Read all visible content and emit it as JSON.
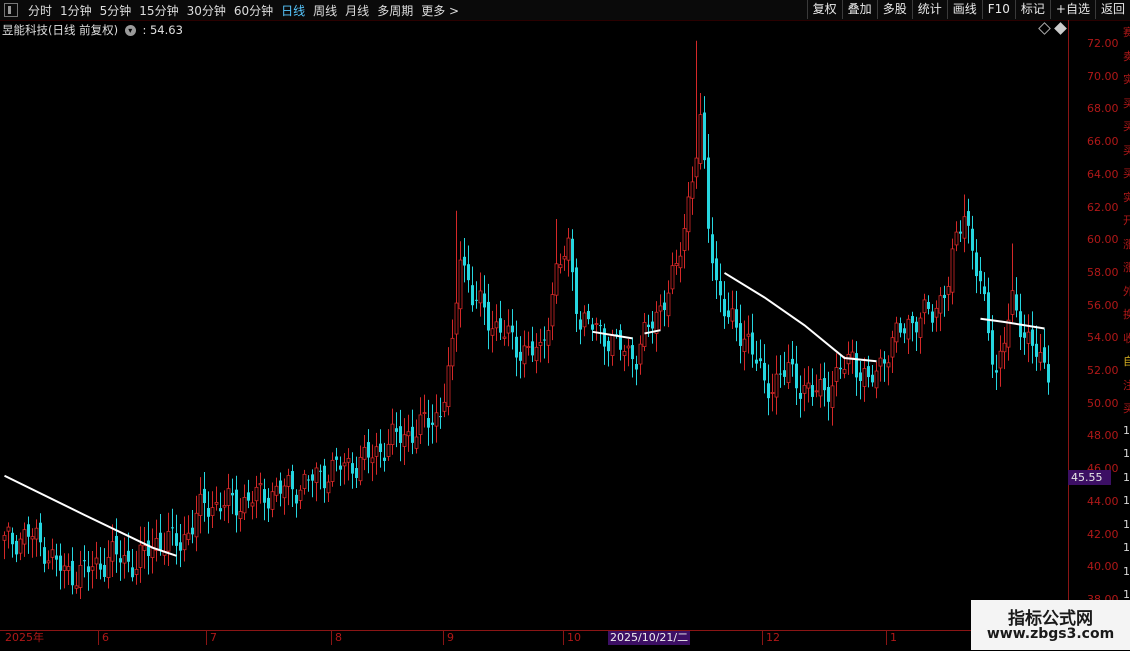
{
  "toolbar": {
    "periods": [
      "分时",
      "1分钟",
      "5分钟",
      "15分钟",
      "30分钟",
      "60分钟",
      "日线",
      "周线",
      "月线",
      "多周期",
      "更多 >"
    ],
    "active_period": "日线",
    "tools": [
      "复权",
      "叠加",
      "多股",
      "统计",
      "画线",
      "F10",
      "标记",
      "+自选",
      "返回"
    ]
  },
  "stock": {
    "name": "昱能科技(日线 前复权)",
    "indicator_text": ": 54.63"
  },
  "price_tag": "45.55",
  "side_labels": [
    {
      "text": "赛",
      "color": "#b01818"
    },
    {
      "text": "卖",
      "color": "#b01818"
    },
    {
      "text": "实",
      "color": "#b01818"
    },
    {
      "text": "买",
      "color": "#b01818"
    },
    {
      "text": "买",
      "color": "#b01818"
    },
    {
      "text": "买",
      "color": "#b01818"
    },
    {
      "text": "买",
      "color": "#b01818"
    },
    {
      "text": "实",
      "color": "#b01818"
    },
    {
      "text": "开",
      "color": "#b01818"
    },
    {
      "text": "涨",
      "color": "#b01818"
    },
    {
      "text": "涨",
      "color": "#b01818"
    },
    {
      "text": "外",
      "color": "#b01818"
    },
    {
      "text": "换",
      "color": "#b01818"
    },
    {
      "text": "收",
      "color": "#b01818"
    },
    {
      "text": "自",
      "color": "#d8b020"
    },
    {
      "text": "注",
      "color": "#b01818"
    },
    {
      "text": "买",
      "color": "#b01818"
    },
    {
      "text": "1",
      "color": "#d8d8d8"
    },
    {
      "text": "1",
      "color": "#d8d8d8"
    },
    {
      "text": "1",
      "color": "#d8d8d8"
    },
    {
      "text": "1",
      "color": "#d8d8d8"
    },
    {
      "text": "1",
      "color": "#d8d8d8"
    },
    {
      "text": "1",
      "color": "#d8d8d8"
    },
    {
      "text": "1",
      "color": "#d8d8d8"
    },
    {
      "text": "1",
      "color": "#d8d8d8"
    },
    {
      "text": "1",
      "color": "#d8d8d8"
    }
  ],
  "x_axis": {
    "labels": [
      "2025年",
      "6",
      "7",
      "8",
      "9",
      "10",
      "12",
      "1"
    ],
    "selected_date": "2025/10/21/二"
  },
  "watermark": {
    "title": "指标公式网",
    "url": "www.zbgs3.com"
  },
  "chart_data": {
    "type": "candlestick",
    "ylim": [
      36.8,
      73.2
    ],
    "y_ticks": [
      "72.00",
      "70.00",
      "68.00",
      "66.00",
      "64.00",
      "62.00",
      "60.00",
      "58.00",
      "56.00",
      "54.00",
      "52.00",
      "50.00",
      "48.00",
      "46.00",
      "44.00",
      "42.00",
      "40.00",
      "38.00"
    ],
    "colors": {
      "up": "#d42828",
      "down": "#26d6e0",
      "line": "#ffffff"
    },
    "waypoints": [
      {
        "bar": 0,
        "close": 41.5
      },
      {
        "bar": 6,
        "close": 42.0
      },
      {
        "bar": 10,
        "close": 41.2
      },
      {
        "bar": 15,
        "close": 39.6
      },
      {
        "bar": 21,
        "close": 39.8
      },
      {
        "bar": 27,
        "close": 40.7
      },
      {
        "bar": 33,
        "close": 40.2
      },
      {
        "bar": 38,
        "close": 41.6
      },
      {
        "bar": 44,
        "close": 41.5
      },
      {
        "bar": 50,
        "close": 43.8
      },
      {
        "bar": 58,
        "close": 43.9
      },
      {
        "bar": 66,
        "close": 44.5
      },
      {
        "bar": 74,
        "close": 45.0
      },
      {
        "bar": 82,
        "close": 46.0
      },
      {
        "bar": 90,
        "close": 46.5
      },
      {
        "bar": 97,
        "close": 47.8
      },
      {
        "bar": 104,
        "close": 48.5
      },
      {
        "bar": 109,
        "close": 49.5
      },
      {
        "bar": 112,
        "close": 53.0
      },
      {
        "bar": 114,
        "close": 59.5
      },
      {
        "bar": 117,
        "close": 56.5
      },
      {
        "bar": 122,
        "close": 55.0
      },
      {
        "bar": 128,
        "close": 53.5
      },
      {
        "bar": 134,
        "close": 53.0
      },
      {
        "bar": 138,
        "close": 58.0
      },
      {
        "bar": 141,
        "close": 59.5
      },
      {
        "bar": 144,
        "close": 55.0
      },
      {
        "bar": 149,
        "close": 54.5
      },
      {
        "bar": 153,
        "close": 53.5
      },
      {
        "bar": 158,
        "close": 53.0
      },
      {
        "bar": 163,
        "close": 55.5
      },
      {
        "bar": 168,
        "close": 58.0
      },
      {
        "bar": 172,
        "close": 64.0
      },
      {
        "bar": 174,
        "close": 67.0
      },
      {
        "bar": 176,
        "close": 61.0
      },
      {
        "bar": 178,
        "close": 57.5
      },
      {
        "bar": 181,
        "close": 55.0
      },
      {
        "bar": 186,
        "close": 54.0
      },
      {
        "bar": 190,
        "close": 51.0
      },
      {
        "bar": 196,
        "close": 52.0
      },
      {
        "bar": 202,
        "close": 50.5
      },
      {
        "bar": 208,
        "close": 51.5
      },
      {
        "bar": 212,
        "close": 53.0
      },
      {
        "bar": 216,
        "close": 51.0
      },
      {
        "bar": 220,
        "close": 53.0
      },
      {
        "bar": 226,
        "close": 55.0
      },
      {
        "bar": 232,
        "close": 55.5
      },
      {
        "bar": 236,
        "close": 57.5
      },
      {
        "bar": 240,
        "close": 62.0
      },
      {
        "bar": 244,
        "close": 57.0
      },
      {
        "bar": 248,
        "close": 52.0
      },
      {
        "bar": 252,
        "close": 56.0
      },
      {
        "bar": 255,
        "close": 54.5
      },
      {
        "bar": 260,
        "close": 52.0
      }
    ],
    "overlay_segments": [
      [
        [
          0,
          45.6
        ],
        [
          20,
          43.2
        ],
        [
          37,
          41.2
        ],
        [
          43,
          40.7
        ]
      ],
      [
        [
          147,
          54.4
        ],
        [
          157,
          54.0
        ]
      ],
      [
        [
          160,
          54.3
        ],
        [
          164,
          54.5
        ]
      ],
      [
        [
          180,
          58.0
        ],
        [
          190,
          56.5
        ],
        [
          200,
          54.8
        ],
        [
          210,
          52.8
        ],
        [
          218,
          52.6
        ]
      ],
      [
        [
          244,
          55.2
        ],
        [
          250,
          55.0
        ],
        [
          260,
          54.6
        ]
      ]
    ]
  }
}
